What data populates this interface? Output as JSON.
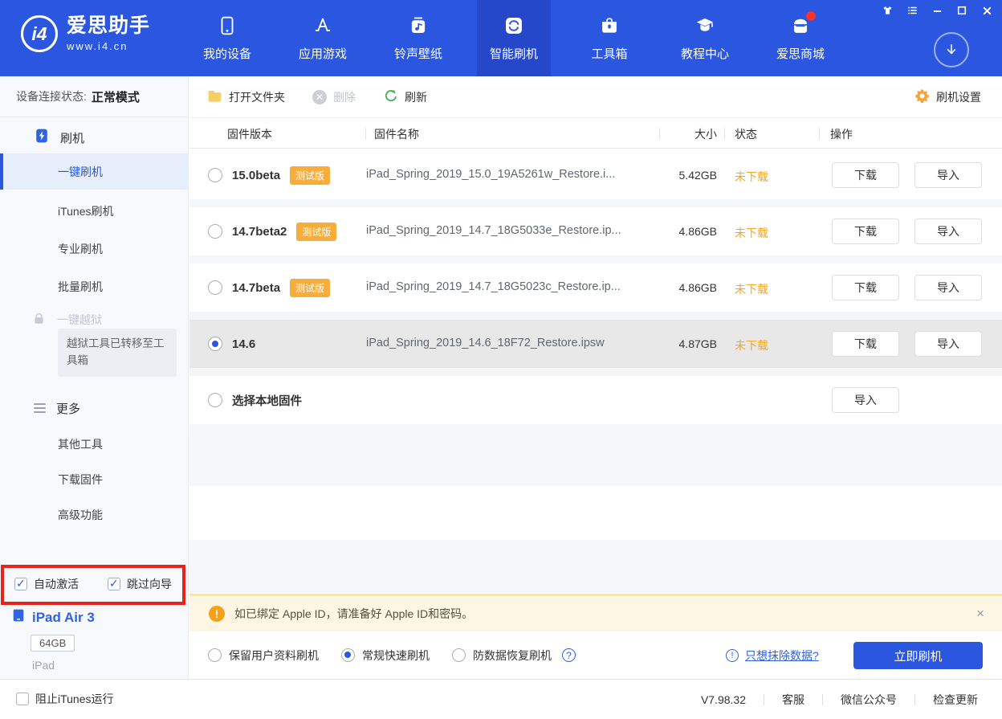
{
  "colors": {
    "accent": "#2B57E0",
    "accent_dark": "#2448C9",
    "status_orange": "#F5A623",
    "badge_orange": "#F6AD3C",
    "annotation_red": "#E8231A",
    "warning_bg": "#FDF6E2",
    "warning_border": "#F0D37A",
    "refresh_green": "#43AF52",
    "selected_row_gray": "#E8E8E8"
  },
  "titlebar": {
    "icons": [
      "skin-icon",
      "list-icon",
      "minimize-icon",
      "maximize-icon",
      "close-icon"
    ]
  },
  "header": {
    "logo_mark": "i4",
    "logo_title": "爱思助手",
    "logo_url": "www.i4.cn",
    "download_icon": "download-arrow-circle",
    "nav": [
      {
        "label": "我的设备",
        "icon": "phone-icon"
      },
      {
        "label": "应用游戏",
        "icon": "appstore-icon"
      },
      {
        "label": "铃声壁纸",
        "icon": "ringtone-icon"
      },
      {
        "label": "智能刷机",
        "icon": "sync-icon",
        "active": true
      },
      {
        "label": "工具箱",
        "icon": "toolbox-icon"
      },
      {
        "label": "教程中心",
        "icon": "graduation-icon"
      },
      {
        "label": "爱思商城",
        "icon": "store-icon",
        "notification_dot": true
      }
    ]
  },
  "sidebar": {
    "connection_label": "设备连接状态:",
    "connection_value": "正常模式",
    "group_flash": "刷机",
    "items_flash": [
      "一键刷机",
      "iTunes刷机",
      "专业刷机",
      "批量刷机"
    ],
    "active_item": "一键刷机",
    "jailbreak": "一键越狱",
    "jailbreak_disabled": true,
    "jailbreak_notice": "越狱工具已转移至工具箱",
    "group_more": "更多",
    "items_more": [
      "其他工具",
      "下载固件",
      "高级功能"
    ],
    "checkboxes": [
      {
        "label": "自动激活",
        "checked": true
      },
      {
        "label": "跳过向导",
        "checked": true
      }
    ],
    "device": {
      "name": "iPad Air 3",
      "capacity": "64GB",
      "type": "iPad"
    }
  },
  "main": {
    "toolbar": {
      "open_folder": "打开文件夹",
      "delete": "删除",
      "delete_disabled": true,
      "refresh": "刷新",
      "settings": "刷机设置"
    },
    "table": {
      "headers": [
        "固件版本",
        "固件名称",
        "大小",
        "状态",
        "操作"
      ],
      "rows": [
        {
          "version": "15.0beta",
          "beta_badge": "测试版",
          "filename": "iPad_Spring_2019_15.0_19A5261w_Restore.i...",
          "size": "5.42GB",
          "status": "未下载",
          "selected": false
        },
        {
          "version": "14.7beta2",
          "beta_badge": "测试版",
          "filename": "iPad_Spring_2019_14.7_18G5033e_Restore.ip...",
          "size": "4.86GB",
          "status": "未下载",
          "selected": false
        },
        {
          "version": "14.7beta",
          "beta_badge": "测试版",
          "filename": "iPad_Spring_2019_14.7_18G5023c_Restore.ip...",
          "size": "4.86GB",
          "status": "未下载",
          "selected": false
        },
        {
          "version": "14.6",
          "filename": "iPad_Spring_2019_14.6_18F72_Restore.ipsw",
          "size": "4.87GB",
          "status": "未下载",
          "selected": true
        },
        {
          "version": "选择本地固件",
          "local": true,
          "selected": false
        }
      ]
    },
    "actions": {
      "download": "下载",
      "import": "导入"
    },
    "notice": {
      "icon_glyph": "!",
      "text": "如已绑定 Apple ID，请准备好 Apple ID和密码。",
      "close_label": "×"
    },
    "flash_options": {
      "radios": [
        {
          "label": "保留用户资料刷机",
          "selected": false
        },
        {
          "label": "常规快速刷机",
          "selected": true
        },
        {
          "label": "防数据恢复刷机",
          "selected": false,
          "help": true
        }
      ],
      "help_glyph": "?",
      "erase_info_glyph": "!",
      "erase_link": "只想抹除数据?",
      "flash_button": "立即刷机"
    }
  },
  "statusbar": {
    "block_itunes": "阻止iTunes运行",
    "version": "V7.98.32",
    "links": [
      "客服",
      "微信公众号",
      "检查更新"
    ]
  }
}
